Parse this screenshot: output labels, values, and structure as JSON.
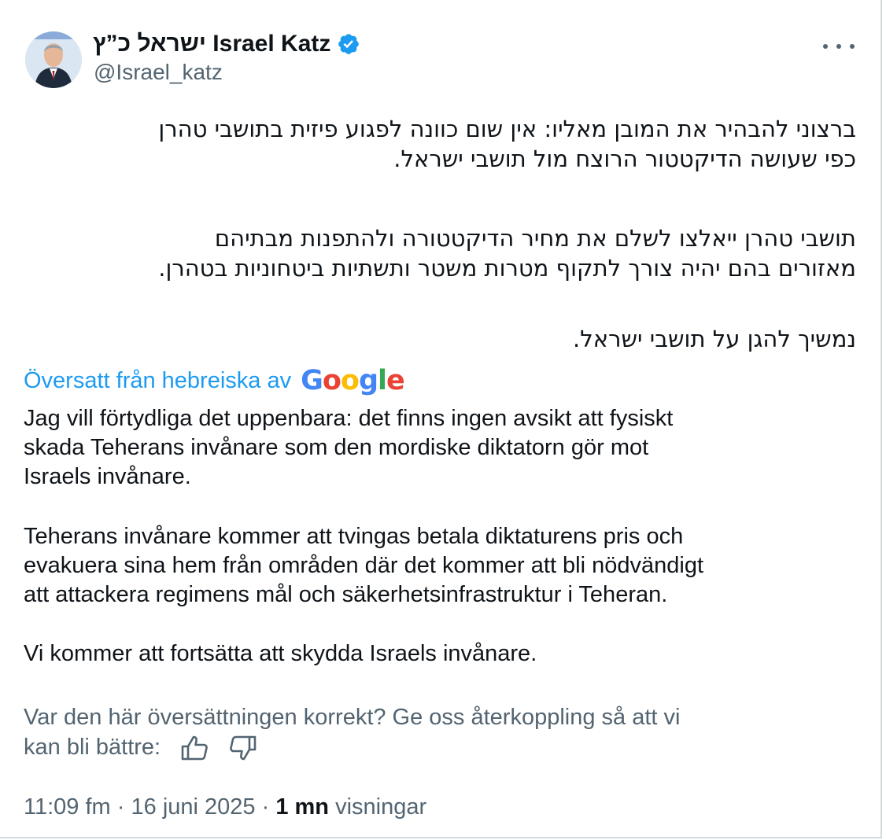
{
  "tweet": {
    "author": {
      "display_name": "ישראל כ”ץ Israel Katz",
      "handle": "@Israel_katz",
      "verified": true
    },
    "hebrew_paragraphs": [
      [
        "ברצוני להבהיר את המובן מאליו: אין שום כוונה לפגוע פיזית בתושבי טהרן",
        "כפי שעושה הדיקטטור הרוצח מול תושבי ישראל."
      ],
      [
        "תושבי טהרן ייאלצו לשלם את מחיר הדיקטטורה ולהתפנות מבתיהם",
        "מאזורים בהם יהיה צורך לתקוף מטרות משטר ותשתיות ביטחוניות בטהרן."
      ],
      [
        "נמשיך להגן על תושבי ישראל."
      ]
    ],
    "translation": {
      "label": "Översatt från hebreiska av",
      "provider": "Google",
      "paragraphs": [
        [
          "Jag vill förtydliga det uppenbara: det finns ingen avsikt att fysiskt",
          "skada Teherans invånare som den mordiske diktatorn gör mot",
          "Israels invånare."
        ],
        [
          "Teherans invånare kommer att tvingas betala diktaturens pris och",
          "evakuera sina hem från områden där det kommer att bli nödvändigt",
          "att attackera regimens mål och säkerhetsinfrastruktur i Teheran."
        ],
        [
          "Vi kommer att fortsätta att skydda Israels invånare."
        ]
      ],
      "feedback_line1": "Var den här översättningen korrekt? Ge oss återkoppling så att vi",
      "feedback_line2": "kan bli bättre:"
    },
    "meta": {
      "time": "11:09 fm",
      "separator": "·",
      "date": "16 juni 2025",
      "views_count": "1 mn",
      "views_label": "visningar"
    }
  },
  "icons": {
    "verified": "verified-badge-icon",
    "more": "more-horizontal-icon",
    "thumb_up": "thumbs-up-icon",
    "thumb_down": "thumbs-down-icon"
  },
  "colors": {
    "link": "#1d9bf0",
    "secondary_text": "#536471",
    "primary_text": "#0f1419",
    "google_blue": "#4285F4",
    "google_red": "#EA4335",
    "google_yellow": "#FBBC05",
    "google_green": "#34A853"
  }
}
